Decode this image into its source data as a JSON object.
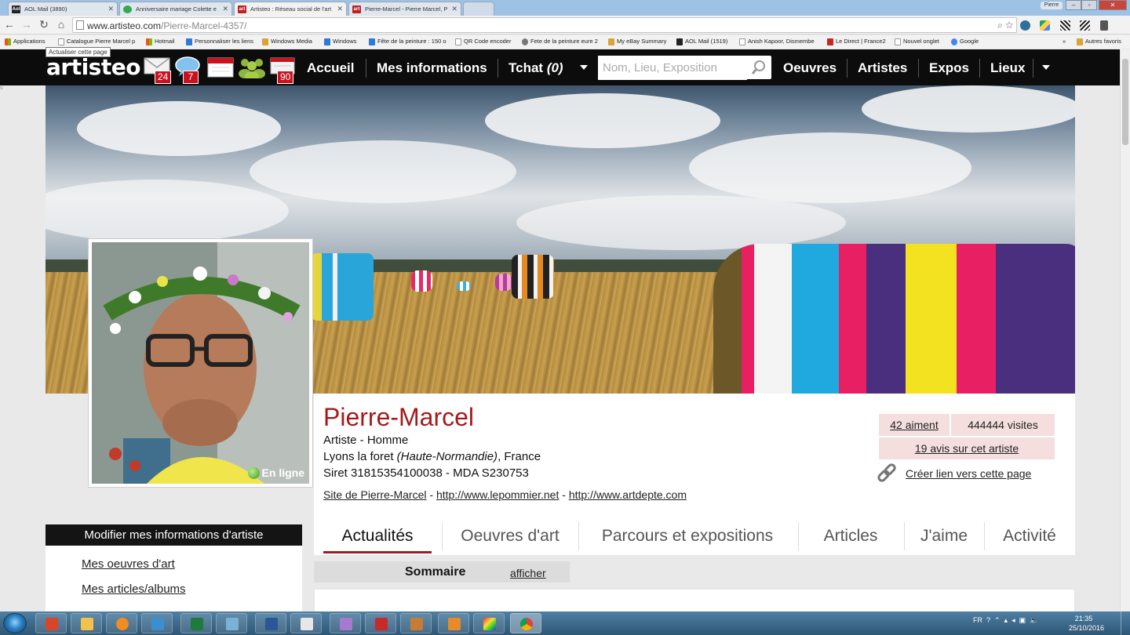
{
  "browser": {
    "tabs": [
      {
        "label": "AOL Mail (3890)",
        "icon": "aol-icon"
      },
      {
        "label": "Anniversaire mariage Colette e",
        "icon": "page-icon"
      },
      {
        "label": "Artisteo : Réseau social de l'art",
        "icon": "artisteo-icon"
      },
      {
        "label": "Pierre-Marcel - Pierre Marcel, P",
        "icon": "artisteo-icon"
      }
    ],
    "user_chip": "Pierre",
    "url_host": "www.artisteo.com",
    "url_path": "/Pierre-Marcel-4357/",
    "tooltip": "Actualiser cette page",
    "bookmarks": [
      "Applications",
      "Catalogue Pierre Marcel p",
      "Hotmail",
      "Personnaliser les liens",
      "Windows Media",
      "Windows",
      "Fête de la peinture : 150 o",
      "QR Code encoder",
      "Fete de la peinture eure 2",
      "My eBay Summary",
      "AOL Mail (1519)",
      "Anish Kapoor, Dismembe",
      "Le Direct | France2",
      "Nouvel onglet",
      "Google"
    ],
    "other_bookmarks": "Autres favoris"
  },
  "site": {
    "logo": "artisteo",
    "badges": {
      "messages": "24",
      "chat": "7",
      "calendar": "",
      "friends": "",
      "notifications": "90"
    },
    "nav": {
      "accueil": "Accueil",
      "mes_informations": "Mes informations",
      "tchat": "Tchat",
      "tchat_count": "(0)",
      "oeuvres": "Oeuvres",
      "artistes": "Artistes",
      "expos": "Expos",
      "lieux": "Lieux"
    },
    "search_placeholder": "Nom, Lieu, Exposition"
  },
  "profile": {
    "online_label": "En ligne",
    "name": "Pierre-Marcel",
    "role": "Artiste - Homme",
    "city": "Lyons la foret",
    "region": "(Haute-Normandie)",
    "country": ", France",
    "siret": "Siret 31815354100038 - MDA S230753",
    "site_link": "Site de Pierre-Marcel",
    "link1": "http://www.lepommier.net",
    "link2": "http://www.artdepte.com",
    "sep": " - ",
    "likes": "42 aiment",
    "visits": "444444 visites",
    "reviews": "19 avis sur cet artiste",
    "create_link": "Créer lien vers cette page",
    "tabs": [
      "Actualités",
      "Oeuvres d'art",
      "Parcours et expositions",
      "Articles",
      "J'aime",
      "Activité"
    ],
    "sommaire": "Sommaire",
    "afficher": "afficher"
  },
  "sidebar": {
    "title": "Modifier mes informations d'artiste",
    "items": [
      "Mes oeuvres d'art",
      "Mes articles/albums"
    ]
  },
  "taskbar": {
    "lang": "FR",
    "time": "21:35",
    "date": "25/10/2016"
  },
  "colors": {
    "accent": "#a51b1b",
    "header_bg": "#0c0c0c",
    "badge": "#c9121e",
    "stat_bg": "#f5dede"
  }
}
